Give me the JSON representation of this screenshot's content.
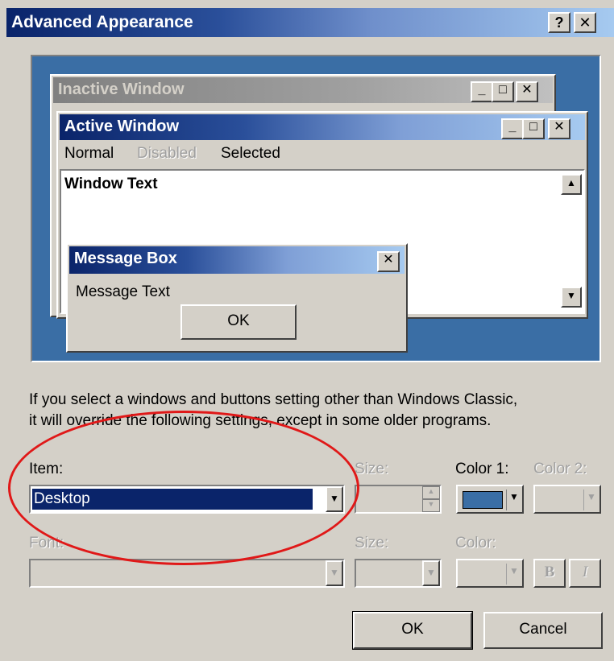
{
  "dialog": {
    "title": "Advanced Appearance",
    "help_label": "?",
    "close_label": "✕"
  },
  "preview": {
    "inactive_title": "Inactive Window",
    "active_title": "Active Window",
    "menu": {
      "normal": "Normal",
      "disabled": "Disabled",
      "selected": "Selected"
    },
    "window_text": "Window Text",
    "message_box": {
      "title": "Message Box",
      "text": "Message Text",
      "ok_label": "OK"
    },
    "caption_buttons": {
      "min": "_",
      "max": "□",
      "close": "✕"
    }
  },
  "info_text_line1": "If you select a windows and buttons setting other than Windows Classic,",
  "info_text_line2": "it will override the following settings, except in some older programs.",
  "item_row": {
    "item_label": "Item:",
    "item_value": "Desktop",
    "size_label": "Size:",
    "color1_label": "Color 1:",
    "color2_label": "Color 2:",
    "color1_value": "#3a6ea5"
  },
  "font_row": {
    "font_label": "Font:",
    "size_label": "Size:",
    "color_label": "Color:",
    "bold_label": "B",
    "italic_label": "I"
  },
  "buttons": {
    "ok": "OK",
    "cancel": "Cancel"
  },
  "annotation": {
    "color": "#e01818"
  }
}
